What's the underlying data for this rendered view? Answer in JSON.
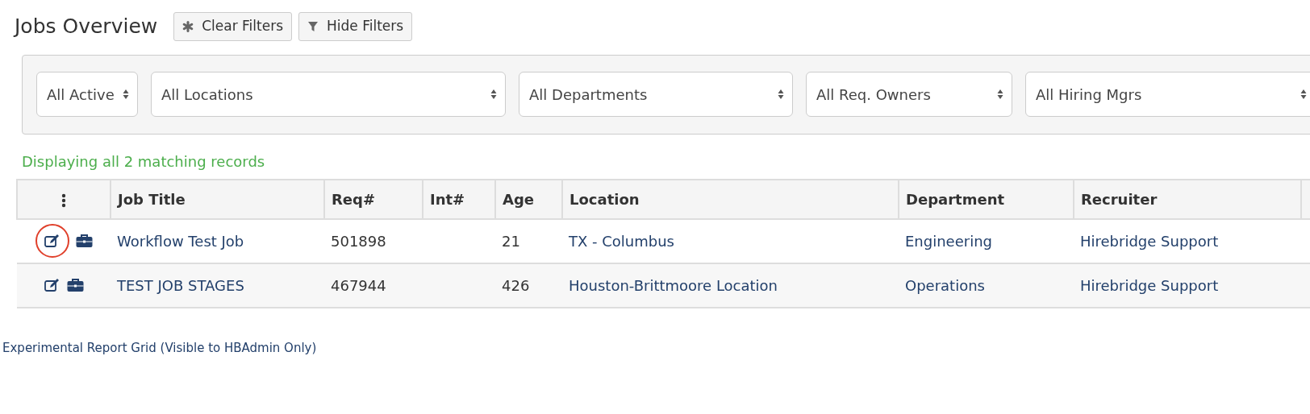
{
  "title": "Jobs Overview",
  "buttons": [
    {
      "kind": "asterisk",
      "label": "Clear Filters"
    },
    {
      "kind": "filter",
      "label": "Hide Filters"
    }
  ],
  "filters": [
    {
      "value": "All Active"
    },
    {
      "value": "All Locations"
    },
    {
      "value": "All Departments"
    },
    {
      "value": "All Req. Owners"
    },
    {
      "value": "All Hiring Mgrs"
    }
  ],
  "summary": "Displaying all 2 matching records",
  "table": {
    "columns": [
      "Job Title",
      "Req#",
      "Int#",
      "Age",
      "Location",
      "Department",
      "Recruiter"
    ],
    "rows": [
      {
        "edit_circled": true,
        "cells": [
          "Workflow Test Job",
          "501898",
          "",
          "21",
          "TX - Columbus",
          "Engineering",
          "Hirebridge Support"
        ]
      },
      {
        "edit_circled": false,
        "cells": [
          "TEST JOB STAGES",
          "467944",
          "",
          "426",
          "Houston-Brittmoore Location",
          "Operations",
          "Hirebridge Support"
        ]
      }
    ]
  },
  "footer_link": "Experimental Report Grid (Visible to HBAdmin Only)"
}
